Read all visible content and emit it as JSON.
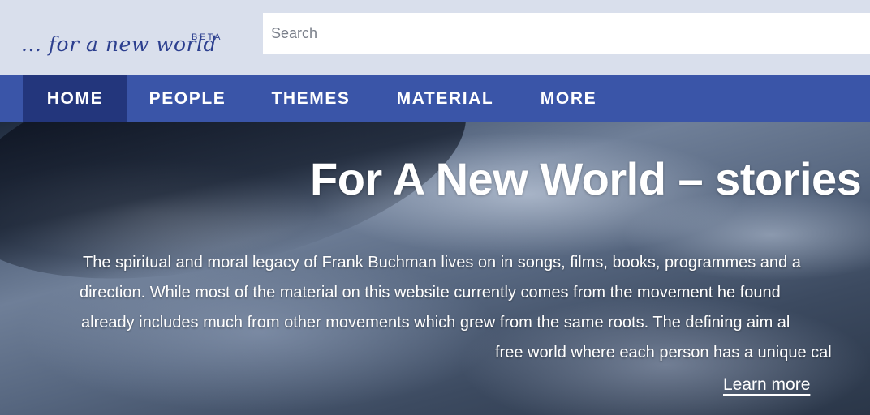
{
  "header": {
    "logo_text": "... for a new world",
    "beta_label": "BETA",
    "search_placeholder": "Search"
  },
  "nav": {
    "items": [
      {
        "label": "HOME",
        "active": true
      },
      {
        "label": "PEOPLE",
        "active": false
      },
      {
        "label": "THEMES",
        "active": false
      },
      {
        "label": "MATERIAL",
        "active": false
      },
      {
        "label": "MORE",
        "active": false
      }
    ]
  },
  "hero": {
    "title": "For A New World – stories",
    "lines": [
      "The spiritual and moral legacy of Frank Buchman lives on in songs, films, books, programmes and a",
      "direction. While most of the material on this website currently comes from the movement he found",
      "already includes much from other movements which grew from the same roots. The defining aim al",
      "free world where each person has a unique cal"
    ],
    "learn_more": "Learn more"
  },
  "colors": {
    "header_bg": "#d9dfec",
    "nav_bg": "#3a55a8",
    "nav_active_bg": "#23367c",
    "logo": "#2c3f8f"
  }
}
